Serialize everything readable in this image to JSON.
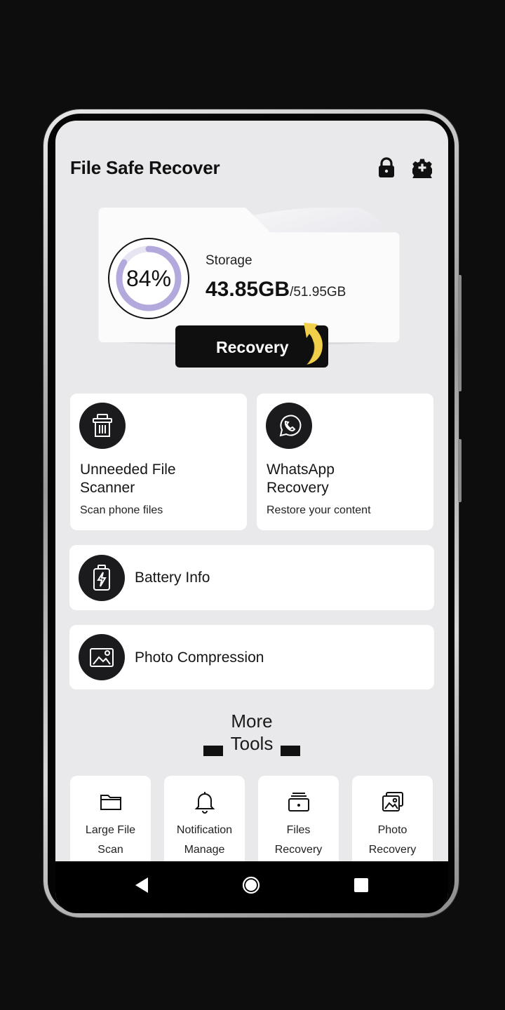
{
  "header": {
    "title": "File Safe Recover",
    "icons": [
      "lock-icon",
      "gear-icon"
    ]
  },
  "storage": {
    "percent_label": "84%",
    "percent_value": 84,
    "label": "Storage",
    "used": "43.85GB",
    "total": "/51.95GB",
    "button_label": "Recovery"
  },
  "feature_cards": [
    {
      "title_line1": "Unneeded File",
      "title_line2": "Scanner",
      "subtitle": "Scan phone files",
      "icon": "trash-bin-icon"
    },
    {
      "title_line1": "WhatsApp",
      "title_line2": "Recovery",
      "subtitle": "Restore your content",
      "icon": "whatsapp-icon"
    }
  ],
  "wide_cards": [
    {
      "title": "Battery Info",
      "icon": "battery-icon"
    },
    {
      "title": "Photo Compression",
      "icon": "image-icon"
    }
  ],
  "more_tools": {
    "heading_line1": "More",
    "heading_line2": "Tools",
    "items": [
      {
        "line1": "Large File",
        "line2": "Scan",
        "icon": "folder-icon"
      },
      {
        "line1": "Notification",
        "line2": "Manage",
        "icon": "bell-icon"
      },
      {
        "line1": "Files",
        "line2": "Recovery",
        "icon": "file-box-icon"
      },
      {
        "line1": "Photo",
        "line2": "Recovery",
        "icon": "photo-icon"
      }
    ]
  },
  "colors": {
    "accent": "#b3a9dd",
    "arrow": "#f2cf4a",
    "background": "#e9e9eb",
    "dark": "#111111"
  }
}
